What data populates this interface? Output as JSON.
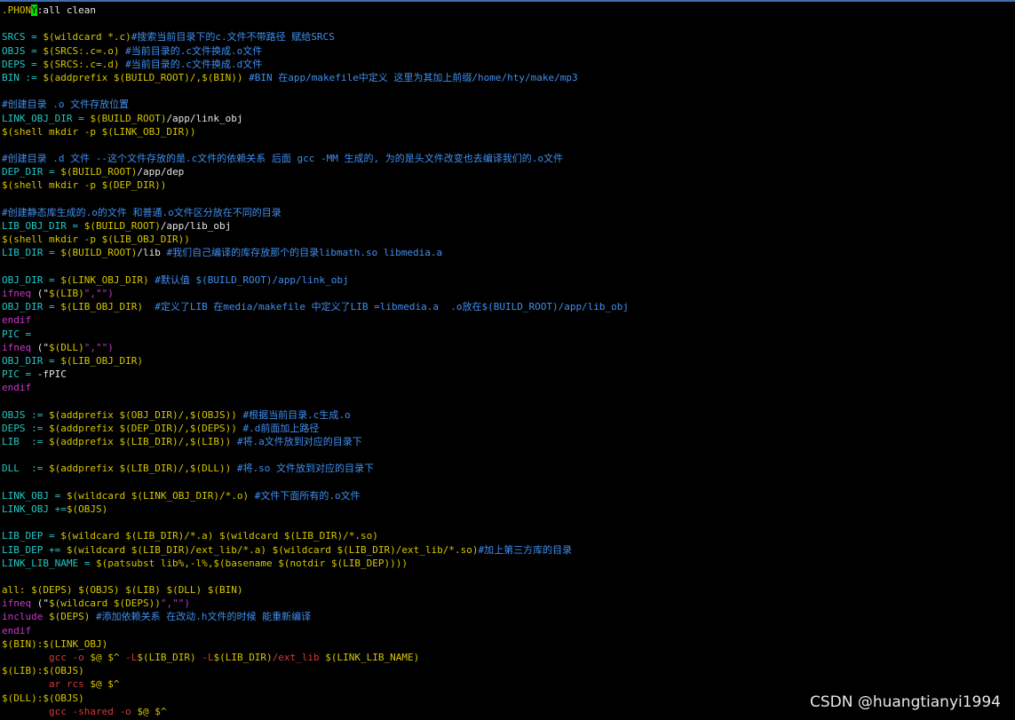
{
  "colors": {
    "background": "#000000",
    "text_white": "#e6e6e6",
    "text_yellow": "#d6c600",
    "text_cyan": "#22c7c7",
    "comment_blue": "#3f8ff0",
    "keyword_magenta": "#c837c8",
    "command_red": "#d23a3a",
    "cursor_green": "#00e000"
  },
  "editor": {
    "lines": [
      [
        {
          "t": ".PHON",
          "c": "y"
        },
        {
          "t": "Y",
          "c": "cur"
        },
        {
          "t": ":all clean",
          "c": "w"
        }
      ],
      [],
      [
        {
          "t": "SRCS = ",
          "c": "c"
        },
        {
          "t": "$(",
          "c": "y"
        },
        {
          "t": "wildcard",
          "c": "y"
        },
        {
          "t": " *.c)",
          "c": "y"
        },
        {
          "t": "#搜索当前目录下的c.文件不带路径 赋给SRCS",
          "c": "b"
        }
      ],
      [
        {
          "t": "OBJS = ",
          "c": "c"
        },
        {
          "t": "$(SRCS:.c=.o)",
          "c": "y"
        },
        {
          "t": " #当前目录的.c文件换成.o文件",
          "c": "b"
        }
      ],
      [
        {
          "t": "DEPS = ",
          "c": "c"
        },
        {
          "t": "$(SRCS:.c=.d)",
          "c": "y"
        },
        {
          "t": " #当前目录的.c文件换成.d文件",
          "c": "b"
        }
      ],
      [
        {
          "t": "BIN := ",
          "c": "c"
        },
        {
          "t": "$(addprefix $(BUILD_ROOT)/,$(BIN))",
          "c": "y"
        },
        {
          "t": " #BIN 在app/makefile中定义 这里为其加上前缀/home/hty/make/mp3",
          "c": "b"
        }
      ],
      [],
      [
        {
          "t": "#创建目录 .o 文件存放位置",
          "c": "b"
        }
      ],
      [
        {
          "t": "LINK_OBJ_DIR = ",
          "c": "c"
        },
        {
          "t": "$(BUILD_ROOT)",
          "c": "y"
        },
        {
          "t": "/app/link_obj",
          "c": "w"
        }
      ],
      [
        {
          "t": "$(shell mkdir -p $(LINK_OBJ_DIR))",
          "c": "y"
        }
      ],
      [],
      [
        {
          "t": "#创建目录 .d 文件 --这个文件存放的是.c文件的依赖关系 后面 gcc -MM 生成的, 为的是头文件改变也去编译我们的.o文件",
          "c": "b"
        }
      ],
      [
        {
          "t": "DEP_DIR = ",
          "c": "c"
        },
        {
          "t": "$(BUILD_ROOT)",
          "c": "y"
        },
        {
          "t": "/app/dep",
          "c": "w"
        }
      ],
      [
        {
          "t": "$(shell mkdir -p $(DEP_DIR))",
          "c": "y"
        }
      ],
      [],
      [
        {
          "t": "#创建静态库生成的.o的文件 和普通.o文件区分放在不同的目录",
          "c": "b"
        }
      ],
      [
        {
          "t": "LIB_OBJ_DIR = ",
          "c": "c"
        },
        {
          "t": "$(BUILD_ROOT)",
          "c": "y"
        },
        {
          "t": "/app/lib_obj",
          "c": "w"
        }
      ],
      [
        {
          "t": "$(shell mkdir -p $(LIB_OBJ_DIR))",
          "c": "y"
        }
      ],
      [
        {
          "t": "LIB_DIR = ",
          "c": "c"
        },
        {
          "t": "$(BUILD_ROOT)",
          "c": "y"
        },
        {
          "t": "/lib",
          "c": "w"
        },
        {
          "t": " #我们自己编译的库存放那个的目录libmath.so libmedia.a",
          "c": "b"
        }
      ],
      [],
      [
        {
          "t": "OBJ_DIR = ",
          "c": "c"
        },
        {
          "t": "$(LINK_OBJ_DIR)",
          "c": "y"
        },
        {
          "t": " #默认值 $(BUILD_ROOT)/app/link_obj",
          "c": "b"
        }
      ],
      [
        {
          "t": "ifneq",
          "c": "m"
        },
        {
          "t": " (\"",
          "c": "w"
        },
        {
          "t": "$(LIB)",
          "c": "y"
        },
        {
          "t": "\",\"\")",
          "c": "m"
        }
      ],
      [
        {
          "t": "OBJ_DIR = ",
          "c": "c"
        },
        {
          "t": "$(LIB_OBJ_DIR)",
          "c": "y"
        },
        {
          "t": "  #定义了LIB 在media/makefile 中定义了LIB =libmedia.a  .o放在$(BUILD_ROOT)/app/lib_obj",
          "c": "b"
        }
      ],
      [
        {
          "t": "endif",
          "c": "m"
        }
      ],
      [
        {
          "t": "PIC =",
          "c": "c"
        }
      ],
      [
        {
          "t": "ifneq",
          "c": "m"
        },
        {
          "t": " (\"",
          "c": "w"
        },
        {
          "t": "$(DLL)",
          "c": "y"
        },
        {
          "t": "\",\"\")",
          "c": "m"
        }
      ],
      [
        {
          "t": "OBJ_DIR = ",
          "c": "c"
        },
        {
          "t": "$(LIB_OBJ_DIR)",
          "c": "y"
        }
      ],
      [
        {
          "t": "PIC = ",
          "c": "c"
        },
        {
          "t": "-fPIC",
          "c": "w"
        }
      ],
      [
        {
          "t": "endif",
          "c": "m"
        }
      ],
      [],
      [
        {
          "t": "OBJS := ",
          "c": "c"
        },
        {
          "t": "$(addprefix $(OBJ_DIR)/,$(OBJS))",
          "c": "y"
        },
        {
          "t": " #根据当前目录.c生成.o",
          "c": "b"
        }
      ],
      [
        {
          "t": "DEPS := ",
          "c": "c"
        },
        {
          "t": "$(addprefix $(DEP_DIR)/,$(DEPS))",
          "c": "y"
        },
        {
          "t": " #.d前面加上路径",
          "c": "b"
        }
      ],
      [
        {
          "t": "LIB  := ",
          "c": "c"
        },
        {
          "t": "$(addprefix $(LIB_DIR)/,$(LIB))",
          "c": "y"
        },
        {
          "t": " #将.a文件放到对应的目录下",
          "c": "b"
        }
      ],
      [],
      [
        {
          "t": "DLL  := ",
          "c": "c"
        },
        {
          "t": "$(addprefix $(LIB_DIR)/,$(DLL))",
          "c": "y"
        },
        {
          "t": " #将.so 文件放到对应的目录下",
          "c": "b"
        }
      ],
      [],
      [
        {
          "t": "LINK_OBJ = ",
          "c": "c"
        },
        {
          "t": "$(wildcard $(LINK_OBJ_DIR)/*.o)",
          "c": "y"
        },
        {
          "t": " #文件下面所有的.o文件",
          "c": "b"
        }
      ],
      [
        {
          "t": "LINK_OBJ +=",
          "c": "c"
        },
        {
          "t": "$(OBJS)",
          "c": "y"
        }
      ],
      [],
      [
        {
          "t": "LIB_DEP = ",
          "c": "c"
        },
        {
          "t": "$(wildcard $(LIB_DIR)/*.a) $(wildcard $(LIB_DIR)/*.so)",
          "c": "y"
        }
      ],
      [
        {
          "t": "LIB_DEP += ",
          "c": "c"
        },
        {
          "t": "$(wildcard $(LIB_DIR)/ext_lib/*.a) $(wildcard $(LIB_DIR)/ext_lib/*.so)",
          "c": "y"
        },
        {
          "t": "#加上第三方库的目录",
          "c": "b"
        }
      ],
      [
        {
          "t": "LINK_LIB_NAME = ",
          "c": "c"
        },
        {
          "t": "$(patsubst lib%,-l%,$(basename $(notdir $(LIB_DEP))))",
          "c": "y"
        }
      ],
      [],
      [
        {
          "t": "all: ",
          "c": "y"
        },
        {
          "t": "$(DEPS) $(OBJS) $(LIB) $(DLL) $(BIN)",
          "c": "y"
        }
      ],
      [
        {
          "t": "ifneq",
          "c": "m"
        },
        {
          "t": " (\"",
          "c": "w"
        },
        {
          "t": "$(wildcard $(DEPS))",
          "c": "y"
        },
        {
          "t": "\",\"\")",
          "c": "m"
        }
      ],
      [
        {
          "t": "include",
          "c": "m"
        },
        {
          "t": " $(DEPS)",
          "c": "y"
        },
        {
          "t": " #添加依赖关系 在改动.h文件的时候 能重新编译",
          "c": "b"
        }
      ],
      [
        {
          "t": "endif",
          "c": "m"
        }
      ],
      [
        {
          "t": "$(BIN):$(LINK_OBJ)",
          "c": "y"
        }
      ],
      [
        {
          "t": "        ",
          "c": "w"
        },
        {
          "t": "gcc -o ",
          "c": "r"
        },
        {
          "t": "$@ $^ ",
          "c": "y"
        },
        {
          "t": "-L",
          "c": "r"
        },
        {
          "t": "$(LIB_DIR) ",
          "c": "y"
        },
        {
          "t": "-L",
          "c": "r"
        },
        {
          "t": "$(LIB_DIR)",
          "c": "y"
        },
        {
          "t": "/ext_lib ",
          "c": "r"
        },
        {
          "t": "$(LINK_LIB_NAME)",
          "c": "y"
        }
      ],
      [
        {
          "t": "$(LIB):$(OBJS)",
          "c": "y"
        }
      ],
      [
        {
          "t": "        ",
          "c": "w"
        },
        {
          "t": "ar rcs ",
          "c": "r"
        },
        {
          "t": "$@ $^",
          "c": "y"
        }
      ],
      [
        {
          "t": "$(DLL):$(OBJS)",
          "c": "y"
        }
      ],
      [
        {
          "t": "        ",
          "c": "w"
        },
        {
          "t": "gcc -shared -o ",
          "c": "r"
        },
        {
          "t": "$@ $^",
          "c": "y"
        }
      ]
    ]
  },
  "watermark": {
    "text": "CSDN @huangtianyi1994"
  }
}
